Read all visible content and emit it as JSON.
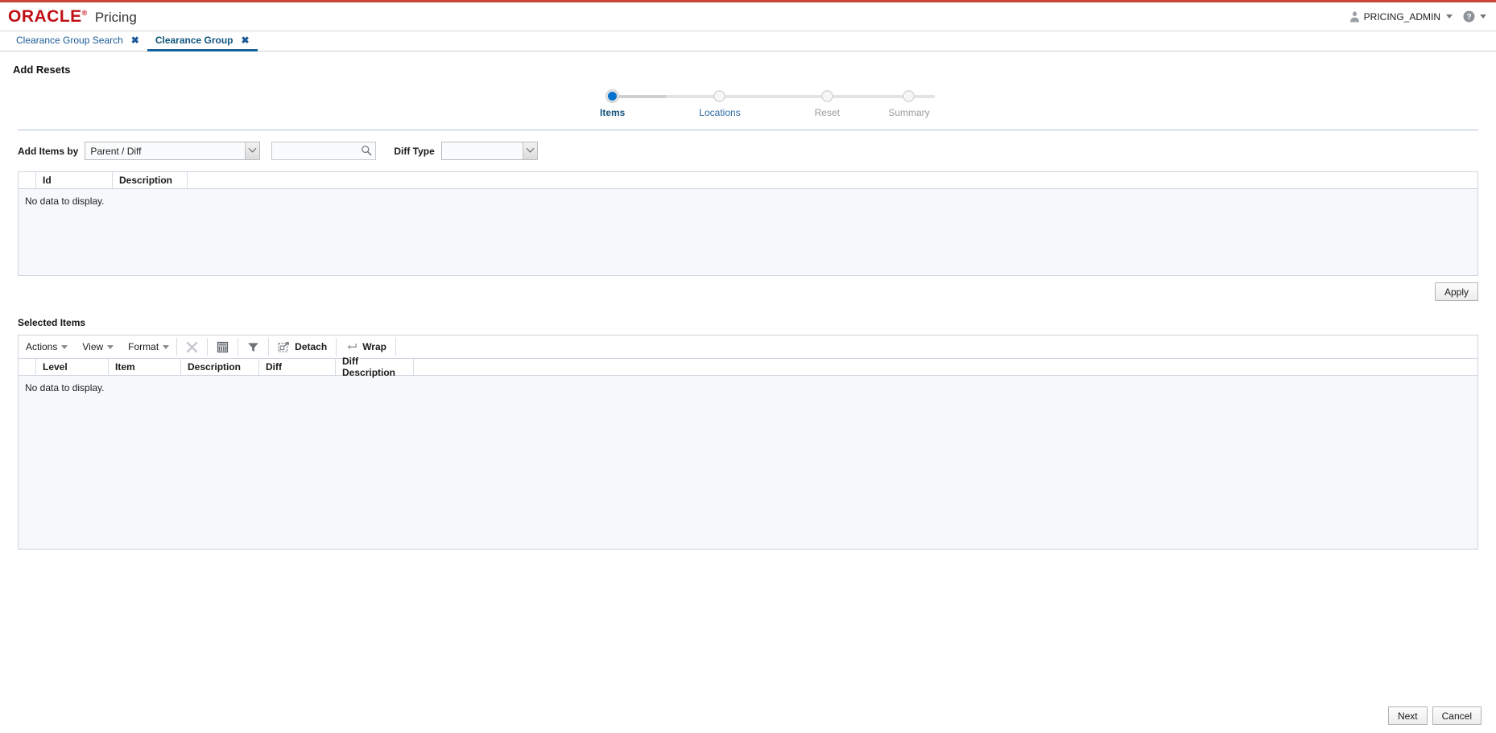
{
  "brand": {
    "logo_text": "ORACLE",
    "trademark": "®",
    "app_name": "Pricing",
    "accent_red": "#c00f15",
    "rule_red": "#c74634",
    "link_blue": "#1a5a96",
    "active_node_blue": "#0572ce"
  },
  "header": {
    "user_name": "PRICING_ADMIN",
    "avatar_icon": "user-avatar-icon",
    "user_caret_icon": "caret-down-icon",
    "help_icon": "help-circle-icon",
    "help_caret_icon": "caret-down-icon"
  },
  "tabs": [
    {
      "label": "Clearance Group Search",
      "active": false,
      "close_icon": "close-icon",
      "close_glyph": "✖"
    },
    {
      "label": "Clearance Group",
      "active": true,
      "close_icon": "close-icon",
      "close_glyph": "✖"
    }
  ],
  "page": {
    "title": "Add Resets"
  },
  "train": {
    "steps": [
      {
        "label": "Items",
        "state": "active"
      },
      {
        "label": "Locations",
        "state": "enabled"
      },
      {
        "label": "Reset",
        "state": "disabled"
      },
      {
        "label": "Summary",
        "state": "disabled"
      }
    ]
  },
  "filters": {
    "add_items_by_label": "Add Items by",
    "add_items_by_value": "Parent / Diff",
    "add_items_by_dropdown_icon": "chevron-down-icon",
    "search_value": "",
    "search_placeholder": "",
    "search_icon": "search-icon",
    "diff_type_label": "Diff Type",
    "diff_type_value": "",
    "diff_type_dropdown_icon": "chevron-down-icon"
  },
  "results_table": {
    "columns": [
      "Id",
      "Description"
    ],
    "rows": [],
    "empty_message": "No data to display."
  },
  "apply_button": {
    "label": "Apply"
  },
  "selected_items": {
    "section_title": "Selected Items",
    "toolbar": {
      "menus": [
        {
          "label": "Actions",
          "caret_icon": "caret-down-icon"
        },
        {
          "label": "View",
          "caret_icon": "caret-down-icon"
        },
        {
          "label": "Format",
          "caret_icon": "caret-down-icon"
        }
      ],
      "icon_buttons": [
        {
          "name": "delete-icon",
          "label": "",
          "disabled": true
        },
        {
          "name": "export-to-excel-icon",
          "label": "",
          "disabled": false
        },
        {
          "name": "filter-funnel-icon",
          "label": "",
          "disabled": false
        }
      ],
      "detach": {
        "label": "Detach",
        "icon": "detach-icon"
      },
      "wrap": {
        "label": "Wrap",
        "icon": "wrap-icon"
      }
    },
    "columns": [
      "Level",
      "Item",
      "Description",
      "Diff",
      "Diff Description"
    ],
    "rows": [],
    "empty_message": "No data to display."
  },
  "footer": {
    "buttons": [
      {
        "label": "Next",
        "name": "next-button"
      },
      {
        "label": "Cancel",
        "name": "cancel-button"
      }
    ]
  }
}
